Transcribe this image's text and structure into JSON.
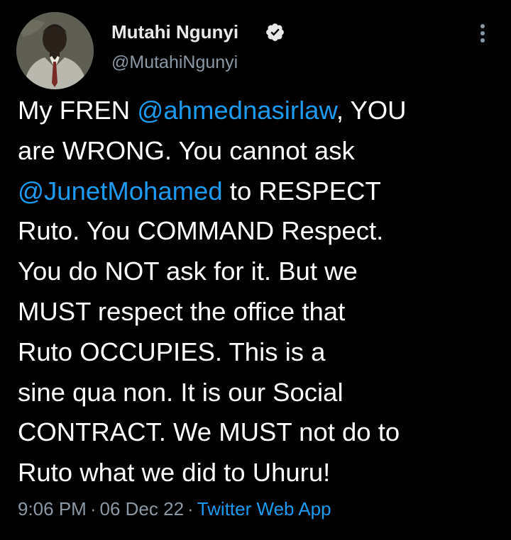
{
  "author": {
    "display_name": "Mutahi Ngunyi",
    "handle": "@MutahiNgunyi",
    "verified": true
  },
  "icons": {
    "verified": "verified-badge-icon",
    "more": "more-options-icon"
  },
  "tweet": {
    "lines": [
      {
        "pre": "My FREN ",
        "mention": "@ahmednasirlaw",
        "post": ", YOU"
      },
      {
        "text": "are WRONG. You cannot ask"
      },
      {
        "mention": "@JunetMohamed",
        "post": " to RESPECT"
      },
      {
        "text": "Ruto. You COMMAND Respect."
      },
      {
        "text": "You do NOT ask for it. But we"
      },
      {
        "text": "MUST respect the office that"
      },
      {
        "text": "Ruto OCCUPIES. This is a"
      },
      {
        "text": "sine qua non. It is our Social"
      },
      {
        "text": "CONTRACT. We MUST not do to"
      },
      {
        "text": "Ruto what we did to Uhuru!"
      }
    ]
  },
  "meta": {
    "time": "9:06 PM",
    "separator": "·",
    "date": "06 Dec 22",
    "source": "Twitter Web App"
  },
  "colors": {
    "background": "#000000",
    "text": "#ffffff",
    "secondary": "#8b98a5",
    "link": "#1d9bf0"
  }
}
